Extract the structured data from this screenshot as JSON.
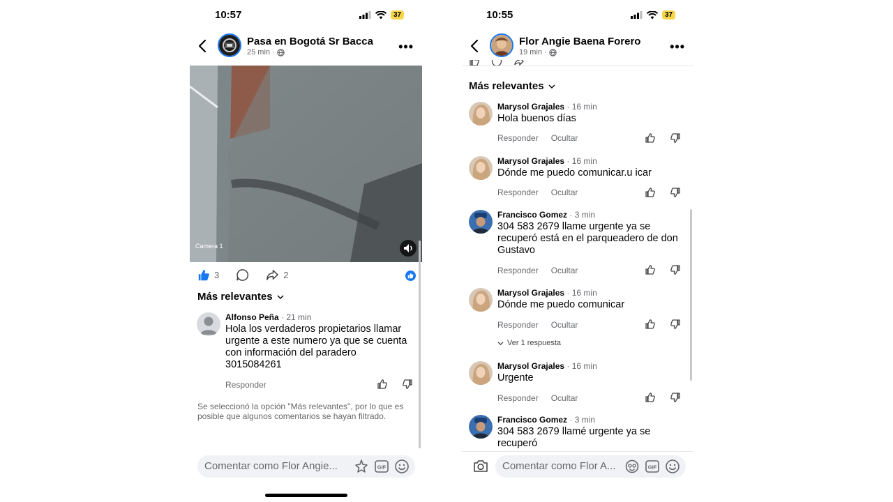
{
  "left": {
    "time": "10:57",
    "battery": "37",
    "page_name": "Pasa en Bogotá Sr Bacca",
    "post_time": "25 min",
    "video_watermark": "Camera 1",
    "likes_count": "3",
    "shares_count": "2",
    "filter_label": "Más relevantes",
    "comments": [
      {
        "author": "Alfonso Peña",
        "time": "21 min",
        "text": "Hola los verdaderos propietarios llamar urgente a este numero ya que se cuenta con información del paradero 3015084261",
        "reply": "Responder"
      }
    ],
    "filter_note": "Se seleccionó la opción \"Más relevantes\", por lo que es posible que algunos comentarios se hayan filtrado.",
    "composer_placeholder": "Comentar como Flor Angie..."
  },
  "right": {
    "time": "10:55",
    "battery": "37",
    "page_name": "Flor Angie Baena Forero",
    "post_time": "19 min",
    "filter_label": "Más relevantes",
    "comments": [
      {
        "author": "Marysol Grajales",
        "time": "16 min",
        "text": "Hola buenos días",
        "reply": "Responder",
        "hide": "Ocultar"
      },
      {
        "author": "Marysol Grajales",
        "time": "16 min",
        "text": "Dónde me puedo comunicar.u icar",
        "reply": "Responder",
        "hide": "Ocultar"
      },
      {
        "author": "Francisco Gomez",
        "time": "3 min",
        "text": "304 583 2679 llame urgente ya se recuperó está en el parqueadero de don Gustavo",
        "reply": "Responder",
        "hide": "Ocultar"
      },
      {
        "author": "Marysol Grajales",
        "time": "16 min",
        "text": "Dónde me puedo comunicar",
        "reply": "Responder",
        "hide": "Ocultar",
        "view_replies": "Ver 1 respuesta"
      },
      {
        "author": "Marysol Grajales",
        "time": "16 min",
        "text": "Urgente",
        "reply": "Responder",
        "hide": "Ocultar"
      },
      {
        "author": "Francisco Gomez",
        "time": "3 min",
        "text": "304 583 2679 llamé urgente ya se recuperó",
        "reply": "",
        "hide": ""
      }
    ],
    "composer_placeholder": "Comentar como Flor A..."
  },
  "colors": {
    "accent": "#1877f2",
    "secondary_text": "#65676b",
    "composer_bg": "#f0f2f5",
    "battery": "#f7d54a"
  }
}
